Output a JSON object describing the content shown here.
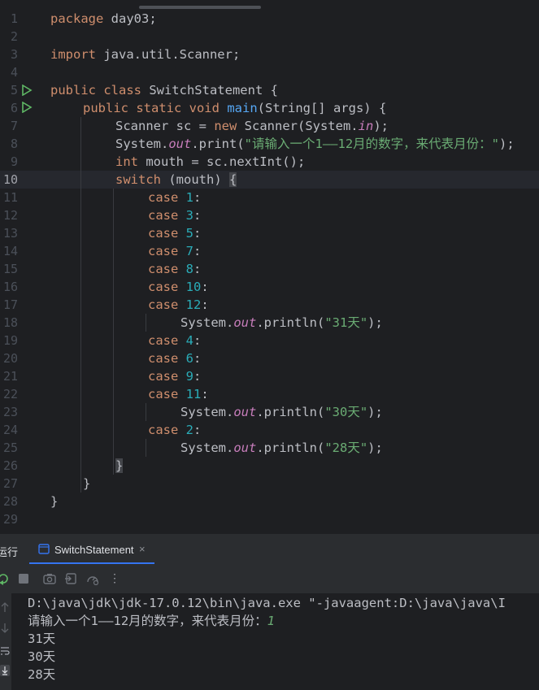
{
  "editor": {
    "line_numbers": [
      "1",
      "2",
      "3",
      "4",
      "5",
      "6",
      "7",
      "8",
      "9",
      "10",
      "11",
      "12",
      "13",
      "14",
      "15",
      "16",
      "17",
      "18",
      "19",
      "20",
      "21",
      "22",
      "23",
      "24",
      "25",
      "26",
      "27",
      "28",
      "29"
    ],
    "current_line": "10",
    "lines": {
      "l1": {
        "kw": "package",
        "rest": " day03;"
      },
      "l3": {
        "kw": "import",
        "rest": " java.util.Scanner;"
      },
      "l5": {
        "kw": "public class",
        "rest": " SwitchStatement {"
      },
      "l6": {
        "kw": "public static void",
        "fn": "main",
        "rest": "(String[] args) {"
      },
      "l7": {
        "a": "Scanner sc = ",
        "kw": "new",
        "b": " Scanner(System.",
        "fld": "in",
        "c": ");"
      },
      "l8": {
        "a": "System.",
        "fld": "out",
        "b": ".print(",
        "str": "\"请输入一个1——12月的数字，来代表月份：\"",
        "c": ");"
      },
      "l9": {
        "kw": "int",
        "rest": " mouth = sc.nextInt();"
      },
      "l10": {
        "kw": "switch",
        "rest": " (mouth) ",
        "brace": "{"
      },
      "cases": [
        {
          "line": "11",
          "num": "1"
        },
        {
          "line": "12",
          "num": "3"
        },
        {
          "line": "13",
          "num": "5"
        },
        {
          "line": "14",
          "num": "7"
        },
        {
          "line": "15",
          "num": "8"
        },
        {
          "line": "16",
          "num": "10"
        },
        {
          "line": "17",
          "num": "12"
        },
        {
          "line": "19",
          "num": "4"
        },
        {
          "line": "20",
          "num": "6"
        },
        {
          "line": "21",
          "num": "9"
        },
        {
          "line": "22",
          "num": "11"
        },
        {
          "line": "24",
          "num": "2"
        }
      ],
      "case_kw": "case",
      "colon": ":",
      "println": {
        "a": "System.",
        "fld": "out",
        "b": ".println(",
        "c": ");"
      },
      "l18_str": "\"31天\"",
      "l23_str": "\"30天\"",
      "l25_str": "\"28天\"",
      "close_switch": "}",
      "close_method": "}",
      "close_class": "}"
    }
  },
  "run_panel": {
    "title": "运行",
    "tab_label": "SwitchStatement",
    "tab_close": "×",
    "more": "⋮"
  },
  "console": {
    "command": "D:\\java\\jdk\\jdk-17.0.12\\bin\\java.exe \"-javaagent:D:\\java\\java\\I",
    "prompt": "请输入一个1——12月的数字，来代表月份：",
    "input": "1",
    "out1": "31天",
    "out2": "30天",
    "out3": "28天"
  },
  "colors": {
    "accent": "#3574f0",
    "run_green": "#5fb865",
    "keyword": "#cf8e6d",
    "string": "#6aab73",
    "number": "#2aacb8",
    "field": "#c77dbb",
    "function": "#56a8f5"
  }
}
